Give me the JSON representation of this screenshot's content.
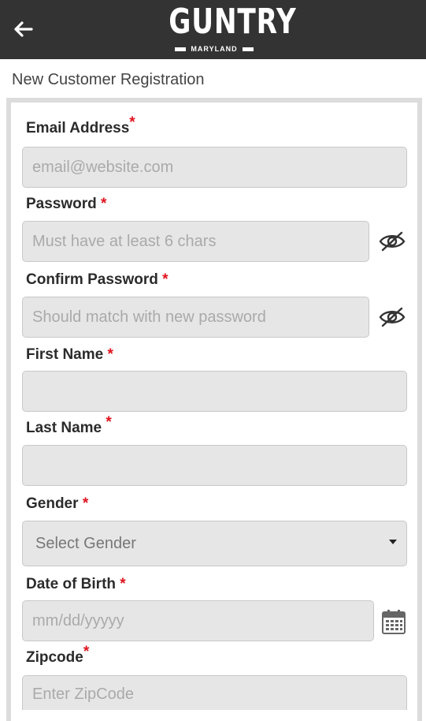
{
  "header": {
    "back_icon": "arrow-left-icon",
    "logo_main": "GUNTRY",
    "logo_sub": "MARYLAND"
  },
  "page_title": "New Customer Registration",
  "form": {
    "email": {
      "label": "Email Address",
      "required": "*",
      "placeholder": "email@website.com"
    },
    "password": {
      "label": "Password",
      "required": "*",
      "placeholder": "Must have at least 6 chars",
      "toggle_icon": "eye-slash-icon"
    },
    "confirm_password": {
      "label": "Confirm Password",
      "required": "*",
      "placeholder": "Should match with new password",
      "toggle_icon": "eye-slash-icon"
    },
    "first_name": {
      "label": "First Name",
      "required": "*",
      "value": ""
    },
    "last_name": {
      "label": "Last Name",
      "required": "*",
      "value": ""
    },
    "gender": {
      "label": "Gender",
      "required": "*",
      "selected": "Select Gender"
    },
    "dob": {
      "label": "Date of Birth",
      "required": "*",
      "placeholder": "mm/dd/yyyyy",
      "icon": "calendar-icon"
    },
    "zipcode": {
      "label": "Zipcode",
      "required": "*",
      "placeholder": "Enter ZipCode"
    }
  },
  "colors": {
    "header_bg": "#333333",
    "required": "#e0141e",
    "field_bg": "#e6e6e6"
  }
}
